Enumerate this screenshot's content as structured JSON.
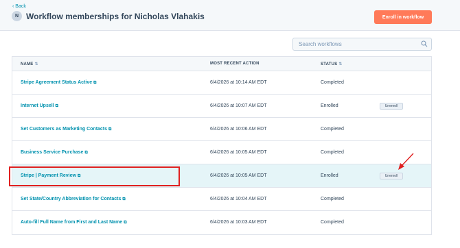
{
  "header": {
    "back_label": "‹ Back",
    "avatar_initial": "N",
    "title": "Workflow memberships for Nicholas Vlahakis",
    "enroll_label": "Enroll in workflow"
  },
  "search": {
    "placeholder": "Search workflows",
    "value": ""
  },
  "table": {
    "columns": [
      {
        "label": "NAME",
        "sortable": true
      },
      {
        "label": "MOST RECENT ACTION",
        "sortable": false
      },
      {
        "label": "STATUS",
        "sortable": true
      }
    ],
    "rows": [
      {
        "name": "Stripe Agreement Status Active",
        "action": "6/4/2026 at 10:14 AM EDT",
        "status": "Completed"
      },
      {
        "name": "Internet Upsell",
        "action": "6/4/2026 at 10:07 AM EDT",
        "status": "Enrolled",
        "button": "Unenroll"
      },
      {
        "name": "Set Customers as Marketing Contacts",
        "action": "6/4/2026 at 10:06 AM EDT",
        "status": "Completed"
      },
      {
        "name": "Business Service Purchase",
        "action": "6/4/2026 at 10:05 AM EDT",
        "status": "Completed"
      },
      {
        "name": "Stripe | Payment Review",
        "action": "6/4/2026 at 10:05 AM EDT",
        "status": "Enrolled",
        "button": "Unenroll"
      },
      {
        "name": "Set State/Country Abbreviation for Contacts",
        "action": "6/4/2026 at 10:04 AM EDT",
        "status": "Completed"
      },
      {
        "name": "Auto-fill Full Name from First and Last Name",
        "action": "6/4/2026 at 10:03 AM EDT",
        "status": "Completed"
      }
    ]
  },
  "icons": {
    "sort": "sort-arrows-icon",
    "external": "external-link-icon",
    "search": "magnifier-icon"
  },
  "colors": {
    "accent": "#ff7a59",
    "link": "#0091ae",
    "highlight_row": "#e5f5f8",
    "annotation": "#e02020"
  }
}
